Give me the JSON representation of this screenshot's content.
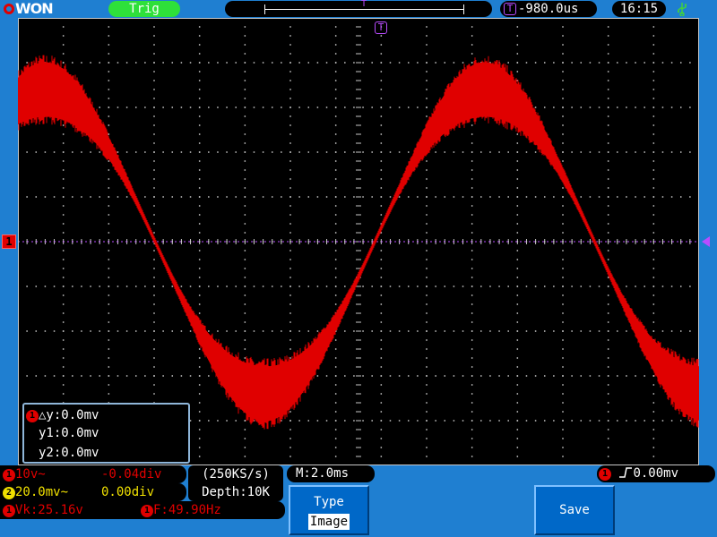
{
  "brand": {
    "logo_text": "WON"
  },
  "colors": {
    "background": "#1f7fd1",
    "screen": "#000000",
    "ch1": "#e00000",
    "ch2": "#f0e000",
    "trigger": "#b94cff",
    "status_ok": "#2ee03a",
    "grid": "#c8c8c8"
  },
  "header": {
    "trig_status": "Trig",
    "trig_marker": "T",
    "trigger_position": "-980.0us",
    "clock": "16:15",
    "usb_icon": "usb-icon"
  },
  "screen": {
    "channel_marker": "1",
    "trigger_marker": "T",
    "divisions": {
      "horizontal": 15,
      "vertical": 10
    }
  },
  "waveform": {
    "channel": 1,
    "color": "#e00000",
    "shape": "sine",
    "amplitude_div": 3.4,
    "noise_band_div_peak": 0.55,
    "visible_cycles": 1.55
  },
  "cursor_panel": {
    "channel_badge": "1",
    "delta_y": "△y:0.0mv",
    "y1": "y1:0.0mv",
    "y2": "y2:0.0mv"
  },
  "channels": [
    {
      "badge": "1",
      "scale": "10v~",
      "offset": "-0.04div"
    },
    {
      "badge": "2",
      "scale": "20.0mv~",
      "offset": "0.00div"
    }
  ],
  "acquisition": {
    "sample_rate": "(250KS/s)",
    "depth": "Depth:10K"
  },
  "timebase": {
    "label": "M:2.0ms"
  },
  "trigger_info": {
    "badge": "1",
    "edge_icon": "rising-edge-icon",
    "level": "0.00mv"
  },
  "measurements": [
    {
      "badge": "1",
      "text": "Vk:25.16v"
    },
    {
      "badge": "1",
      "text": "F:49.90Hz"
    }
  ],
  "menu": {
    "type_label": "Type",
    "type_value": "Image",
    "save_label": "Save"
  }
}
